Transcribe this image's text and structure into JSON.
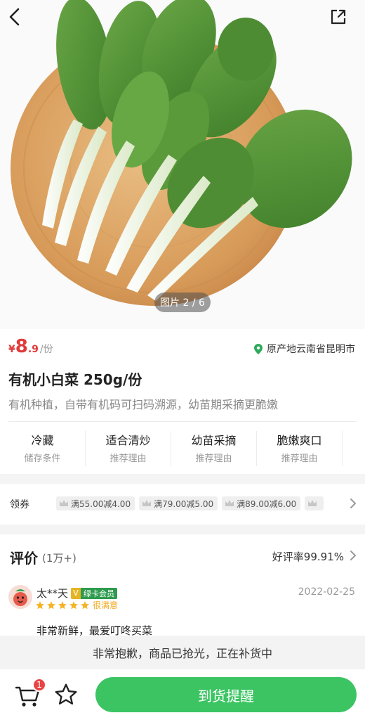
{
  "nav": {
    "back_icon": "chevron-left-icon",
    "share_icon": "share-icon"
  },
  "gallery": {
    "counter": "图片 2 / 6",
    "image_subject": "bok choy on round wooden board"
  },
  "product": {
    "price_symbol": "¥",
    "price_integer": "8",
    "price_decimal": ".9",
    "price_unit": "/份",
    "origin": "原产地云南省昆明市",
    "title": "有机小白菜 250g/份",
    "subtitle": "有机种植，自带有机码可扫码溯源，幼苗期采摘更脆嫩",
    "features": [
      {
        "title": "冷藏",
        "sub": "储存条件"
      },
      {
        "title": "适合清炒",
        "sub": "推荐理由"
      },
      {
        "title": "幼苗采摘",
        "sub": "推荐理由"
      },
      {
        "title": "脆嫩爽口",
        "sub": "推荐理由"
      }
    ]
  },
  "coupons": {
    "label": "领券",
    "items": [
      "满55.00减4.00",
      "满79.00减5.00",
      "满89.00减6.00"
    ]
  },
  "reviews": {
    "title": "评价",
    "count": "(1万+)",
    "good_rate": "好评率99.91%",
    "first": {
      "user": "太**天",
      "vip_v": "V",
      "vip_label": "绿卡会员",
      "date": "2022-02-25",
      "rating_text": "很满意",
      "stars": 5,
      "text": "非常新鲜，最爱叮咚买菜"
    }
  },
  "status_banner": "非常抱歉，商品已抢光，正在补货中",
  "bottom": {
    "cart_badge": "1",
    "notify_button": "到货提醒"
  },
  "colors": {
    "price_red": "#e03a3a",
    "brand_green": "#3cc463",
    "origin_green": "#2eaa5a"
  }
}
